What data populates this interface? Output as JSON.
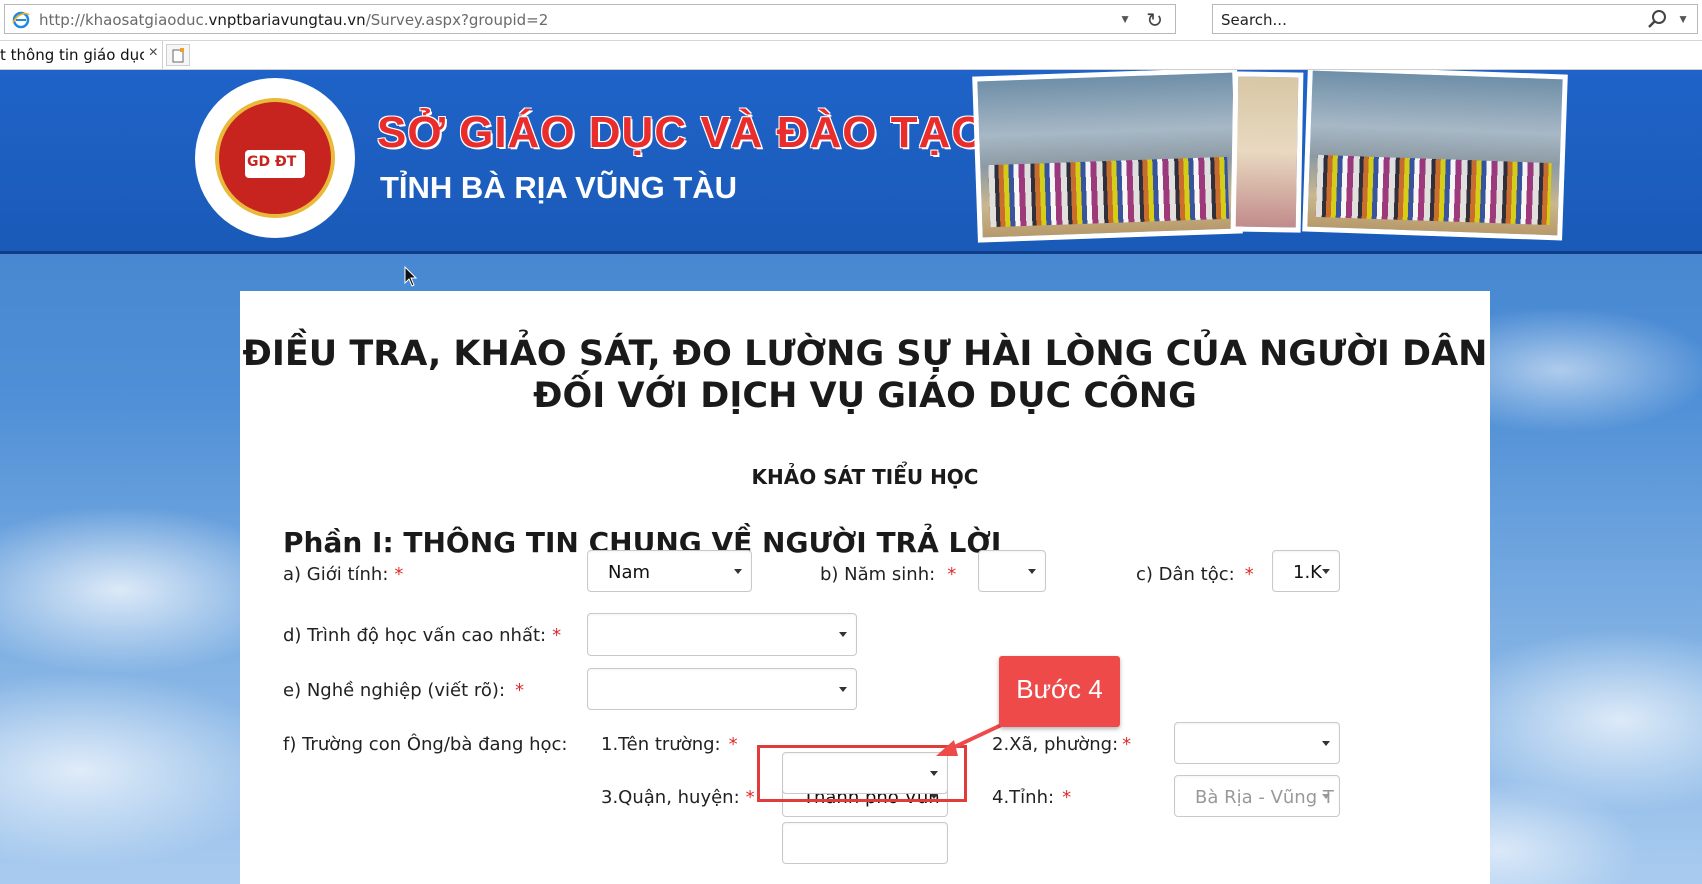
{
  "browser": {
    "url_prefix": "http://khaosatgiaoduc.",
    "url_host": "vnptbariavungtau.vn",
    "url_path": "/Survey.aspx?groupid=2",
    "search_placeholder": "Search...",
    "tab_title": "t thông tin giáo dục...",
    "tab_close": "×"
  },
  "banner": {
    "logo_text": "GD ĐT",
    "title_line1": "SỞ GIÁO DỤC VÀ ĐÀO TẠO",
    "title_line2": "TỈNH BÀ RỊA VŨNG TÀU"
  },
  "form": {
    "title_line1": "ĐIỀU TRA, KHẢO SÁT, ĐO LƯỜNG SỰ HÀI LÒNG CỦA NGƯỜI DÂN",
    "title_line2": "ĐỐI VỚI DỊCH VỤ GIÁO DỤC CÔNG",
    "subtitle": "KHẢO SÁT TIỂU HỌC",
    "section_title": "Phần I: THÔNG TIN CHUNG VỀ NGƯỜI TRẢ LỜI",
    "required_mark": "*",
    "fields": {
      "gender_label": "a) Giới tính:",
      "gender_value": "Nam",
      "birth_year_label": "b) Năm sinh:",
      "birth_year_value": "",
      "ethnicity_label": "c) Dân tộc:",
      "ethnicity_value": "1.K",
      "education_label": "d) Trình độ học vấn cao nhất:",
      "education_value": "",
      "occupation_label": "e) Nghề nghiệp (viết rõ):",
      "occupation_value": "",
      "school_group_label": "f) Trường con Ông/bà đang học:",
      "school_name_label": "1.Tên trường:",
      "school_name_value": "",
      "ward_label": "2.Xã, phường:",
      "ward_value": "",
      "district_label": "3.Quận, huyện:",
      "district_value": "Thành phố Vũn",
      "province_label": "4.Tỉnh:",
      "province_value": "Bà Rịa - Vũng T"
    }
  },
  "annotation": {
    "callout_text": "Bước 4",
    "color": "#ee4a4a"
  }
}
